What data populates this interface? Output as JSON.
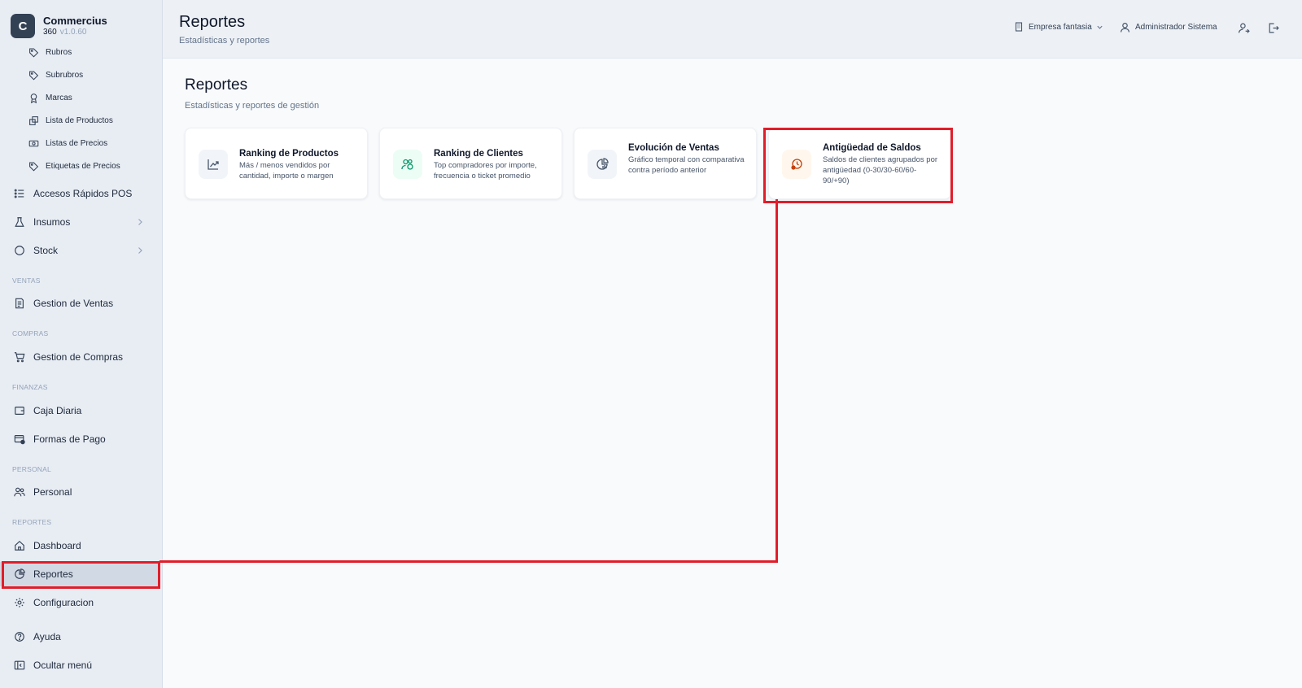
{
  "brand": {
    "logo_letter": "C",
    "name": "Commercius",
    "sub": "360",
    "version": "v1.0.60"
  },
  "sidebar": {
    "sub_items": [
      {
        "label": "Rubros",
        "icon": "tag-icon"
      },
      {
        "label": "Subrubros",
        "icon": "tag-icon"
      },
      {
        "label": "Marcas",
        "icon": "ribbon-icon"
      },
      {
        "label": "Lista de Productos",
        "icon": "boxes-icon"
      },
      {
        "label": "Listas de Precios",
        "icon": "banknote-icon"
      },
      {
        "label": "Etiquetas de Precios",
        "icon": "tag-icon"
      }
    ],
    "accesos": "Accesos Rápidos POS",
    "insumos": "Insumos",
    "stock": "Stock",
    "sections": {
      "ventas": "VENTAS",
      "compras": "COMPRAS",
      "finanzas": "FINANZAS",
      "personal": "PERSONAL",
      "reportes": "REPORTES"
    },
    "gestion_ventas": "Gestion de Ventas",
    "gestion_compras": "Gestion de Compras",
    "caja_diaria": "Caja Diaria",
    "formas_pago": "Formas de Pago",
    "personal": "Personal",
    "dashboard": "Dashboard",
    "reportes": "Reportes",
    "configuracion": "Configuracion",
    "ayuda": "Ayuda",
    "ocultar": "Ocultar menú"
  },
  "header": {
    "title": "Reportes",
    "subtitle": "Estadísticas y reportes",
    "company": "Empresa fantasia",
    "user": "Administrador Sistema"
  },
  "main": {
    "title": "Reportes",
    "subtitle": "Estadísticas y reportes de gestión",
    "cards": [
      {
        "title": "Ranking de Productos",
        "desc": "Más / menos vendidos por cantidad, importe o margen",
        "icon": "trending-up-icon"
      },
      {
        "title": "Ranking de Clientes",
        "desc": "Top compradores por importe, frecuencia o ticket promedio",
        "icon": "users-icon"
      },
      {
        "title": "Evolución de Ventas",
        "desc": "Gráfico temporal con comparativa contra período anterior",
        "icon": "pie-chart-icon"
      },
      {
        "title": "Antigüedad de Saldos",
        "desc": "Saldos de clientes agrupados por antigüedad (0-30/30-60/60-90/+90)",
        "icon": "clock-alert-icon"
      }
    ]
  },
  "colors": {
    "highlight": "#e11d2a",
    "accent": "#334155"
  }
}
